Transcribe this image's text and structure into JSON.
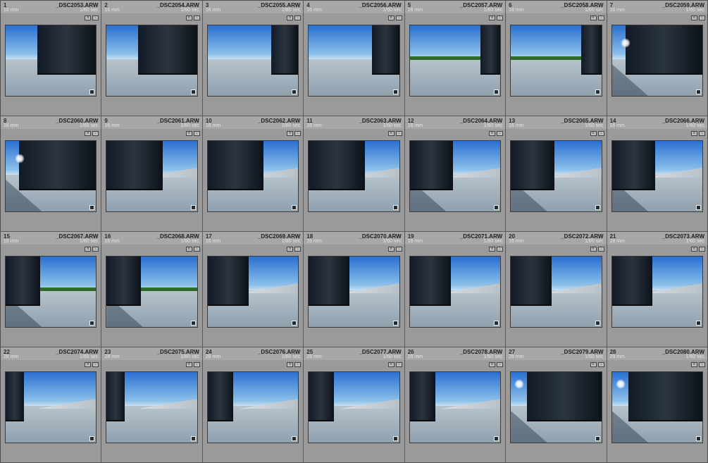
{
  "photos": [
    {
      "idx": "1",
      "file": "_DSC2053.ARW",
      "lens": "16 mm",
      "shutter": "1/60 sec",
      "v": "a"
    },
    {
      "idx": "2",
      "file": "_DSC2054.ARW",
      "lens": "16 mm",
      "shutter": "1/60 sec",
      "v": "a"
    },
    {
      "idx": "3",
      "file": "_DSC2055.ARW",
      "lens": "16 mm",
      "shutter": "1/60 sec",
      "v": "b"
    },
    {
      "idx": "4",
      "file": "_DSC2056.ARW",
      "lens": "16 mm",
      "shutter": "1/60 sec",
      "v": "b"
    },
    {
      "idx": "5",
      "file": "_DSC2057.ARW",
      "lens": "16 mm",
      "shutter": "1/60 sec",
      "v": "c"
    },
    {
      "idx": "6",
      "file": "_DSC2058.ARW",
      "lens": "16 mm",
      "shutter": "1/60 sec",
      "v": "c"
    },
    {
      "idx": "7",
      "file": "_DSC2059.ARW",
      "lens": "16 mm",
      "shutter": "1/60 sec",
      "v": "d"
    },
    {
      "idx": "8",
      "file": "_DSC2060.ARW",
      "lens": "16 mm",
      "shutter": "1/60 sec",
      "v": "d"
    },
    {
      "idx": "9",
      "file": "_DSC2061.ARW",
      "lens": "16 mm",
      "shutter": "1/60 sec",
      "v": "e"
    },
    {
      "idx": "10",
      "file": "_DSC2062.ARW",
      "lens": "16 mm",
      "shutter": "1/60 sec",
      "v": "e"
    },
    {
      "idx": "11",
      "file": "_DSC2063.ARW",
      "lens": "16 mm",
      "shutter": "1/60 sec",
      "v": "e"
    },
    {
      "idx": "12",
      "file": "_DSC2064.ARW",
      "lens": "16 mm",
      "shutter": "1/60 sec",
      "v": "f"
    },
    {
      "idx": "13",
      "file": "_DSC2065.ARW",
      "lens": "16 mm",
      "shutter": "1/60 sec",
      "v": "f"
    },
    {
      "idx": "14",
      "file": "_DSC2066.ARW",
      "lens": "16 mm",
      "shutter": "1/60 sec",
      "v": "f"
    },
    {
      "idx": "15",
      "file": "_DSC2067.ARW",
      "lens": "16 mm",
      "shutter": "1/60 sec",
      "v": "g"
    },
    {
      "idx": "16",
      "file": "_DSC2068.ARW",
      "lens": "16 mm",
      "shutter": "1/60 sec",
      "v": "g"
    },
    {
      "idx": "17",
      "file": "_DSC2069.ARW",
      "lens": "16 mm",
      "shutter": "1/60 sec",
      "v": "h"
    },
    {
      "idx": "18",
      "file": "_DSC2070.ARW",
      "lens": "16 mm",
      "shutter": "1/60 sec",
      "v": "h"
    },
    {
      "idx": "19",
      "file": "_DSC2071.ARW",
      "lens": "16 mm",
      "shutter": "1/60 sec",
      "v": "h"
    },
    {
      "idx": "20",
      "file": "_DSC2072.ARW",
      "lens": "16 mm",
      "shutter": "1/60 sec",
      "v": "h"
    },
    {
      "idx": "21",
      "file": "_DSC2073.ARW",
      "lens": "28 mm",
      "shutter": "1/60 sec",
      "v": "h"
    },
    {
      "idx": "22",
      "file": "_DSC2074.ARW",
      "lens": "28 mm",
      "shutter": "1/60 sec",
      "v": "i"
    },
    {
      "idx": "23",
      "file": "_DSC2075.ARW",
      "lens": "28 mm",
      "shutter": "1/60 sec",
      "v": "i"
    },
    {
      "idx": "24",
      "file": "_DSC2076.ARW",
      "lens": "28 mm",
      "shutter": "1/60 sec",
      "v": "j"
    },
    {
      "idx": "25",
      "file": "_DSC2077.ARW",
      "lens": "28 mm",
      "shutter": "1/60 sec",
      "v": "j"
    },
    {
      "idx": "26",
      "file": "_DSC2078.ARW",
      "lens": "28 mm",
      "shutter": "1/60 sec",
      "v": "j"
    },
    {
      "idx": "27",
      "file": "_DSC2079.ARW",
      "lens": "28 mm",
      "shutter": "1/60 sec",
      "v": "k"
    },
    {
      "idx": "28",
      "file": "_DSC2080.ARW",
      "lens": "28 mm",
      "shutter": "1/60 sec",
      "v": "k"
    }
  ],
  "colors": {
    "cell_bg": "#9a9a9a",
    "header_bg": "#a7a7a7",
    "grid_lines": "#5a5a5a"
  },
  "icons": [
    "metadata-badge-icon",
    "edit-badge-icon",
    "develop-adjustment-icon"
  ]
}
